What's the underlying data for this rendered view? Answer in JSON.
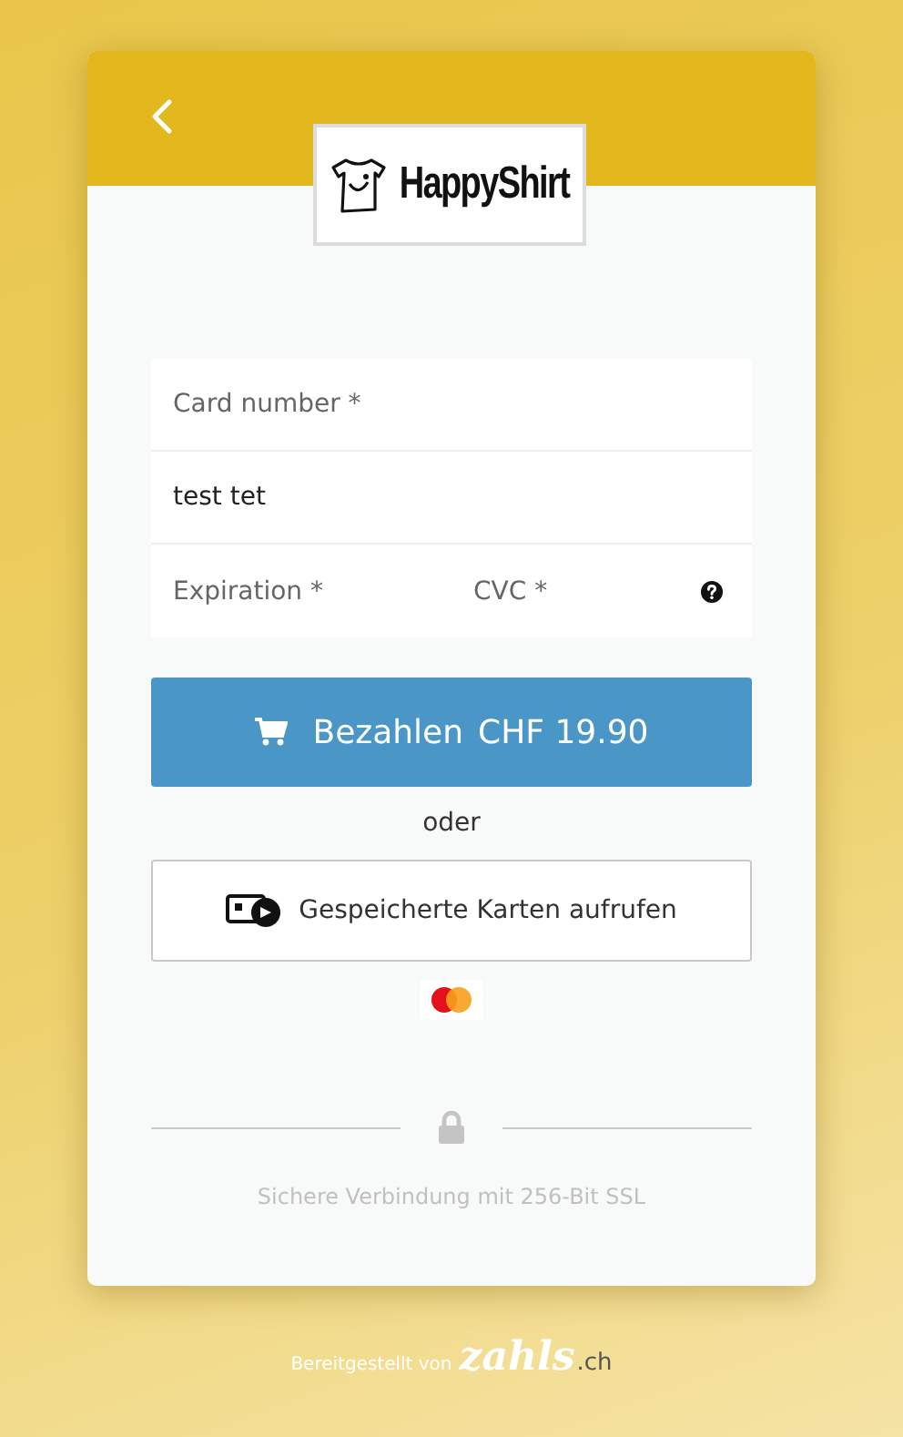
{
  "logo": {
    "text": "HappyShirt"
  },
  "card_number": {
    "placeholder": "Card number *"
  },
  "cardholder": {
    "value": "test tet"
  },
  "expiration": {
    "placeholder": "Expiration *"
  },
  "cvc": {
    "placeholder": "CVC *"
  },
  "pay_button": {
    "label": "Bezahlen",
    "amount": "CHF 19.90"
  },
  "separator": "oder",
  "saved_cards_button": {
    "label": "Gespeicherte Karten aufrufen"
  },
  "security_note": "Sichere Verbindung mit 256-Bit SSL",
  "footer": {
    "prefix": "Bereitgestellt von",
    "brand": "zahls",
    "suffix": ".ch"
  }
}
